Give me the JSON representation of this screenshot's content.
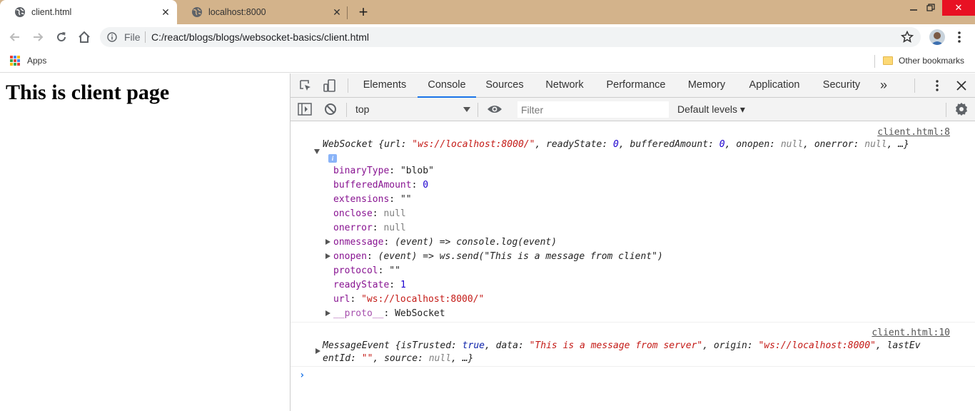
{
  "browser": {
    "tabs": [
      {
        "title": "client.html",
        "active": true
      },
      {
        "title": "localhost:8000",
        "active": false
      }
    ],
    "address": {
      "scheme_label": "File",
      "url": "C:/react/blogs/blogs/websocket-basics/client.html"
    },
    "bookmarks": {
      "apps_label": "Apps",
      "other_label": "Other bookmarks"
    },
    "colors": {
      "tabstrip": "#d3b38b",
      "close": "#e81123",
      "accent": "#1a73e8"
    }
  },
  "page": {
    "heading": "This is client page"
  },
  "devtools": {
    "tabs": [
      "Elements",
      "Console",
      "Sources",
      "Network",
      "Performance",
      "Memory",
      "Application",
      "Security"
    ],
    "active_tab": "Console",
    "more_tabs": "»",
    "context": "top",
    "filter_placeholder": "Filter",
    "levels": "Default levels ▾"
  },
  "console": {
    "entries": [
      {
        "source": "client.html:8",
        "summary": {
          "class": "WebSocket ",
          "open": "{",
          "url_key": "url: ",
          "url_val": "\"ws://localhost:8000/\"",
          "sep1": ", ",
          "rs_key": "readyState: ",
          "rs_val": "0",
          "sep2": ", ",
          "ba_key": "bufferedAmount: ",
          "ba_val": "0",
          "sep3": ", ",
          "onopen_key": "onopen: ",
          "onopen_val": "null",
          "sep4": ", ",
          "onerror_key": "onerror: ",
          "onerror_val": "null",
          "tail": ", …}"
        },
        "props": [
          {
            "key": "binaryType",
            "value": "\"blob\"",
            "kind": "plain"
          },
          {
            "key": "bufferedAmount",
            "value": "0",
            "kind": "num"
          },
          {
            "key": "extensions",
            "value": "\"\"",
            "kind": "plain"
          },
          {
            "key": "onclose",
            "value": "null",
            "kind": "nul"
          },
          {
            "key": "onerror",
            "value": "null",
            "kind": "nul"
          },
          {
            "key": "onmessage",
            "value": "(event) => console.log(event)",
            "kind": "fn"
          },
          {
            "key": "onopen",
            "value": "(event) => ws.send(\"This is a message from client\")",
            "kind": "fn"
          },
          {
            "key": "protocol",
            "value": "\"\"",
            "kind": "plain"
          },
          {
            "key": "readyState",
            "value": "1",
            "kind": "num"
          },
          {
            "key": "url",
            "value": "\"ws://localhost:8000/\"",
            "kind": "str"
          },
          {
            "key": "__proto__",
            "value": "WebSocket",
            "kind": "proto"
          }
        ]
      },
      {
        "source": "client.html:10",
        "line1": {
          "class": "MessageEvent ",
          "open": "{",
          "trusted_key": "isTrusted: ",
          "trusted_val": "true",
          "sep1": ", ",
          "data_key": "data: ",
          "data_val": "\"This is a message from server\"",
          "sep2": ", ",
          "origin_key": "origin: ",
          "origin_val": "\"ws://localhost:8000\"",
          "sep3": ", ",
          "last_key": "lastEv"
        },
        "line2": {
          "last_key_rest": "entId: ",
          "last_val": "\"\"",
          "sep4": ", ",
          "source_key": "source: ",
          "source_val": "null",
          "tail": ", …}"
        }
      }
    ],
    "prompt": "›"
  }
}
